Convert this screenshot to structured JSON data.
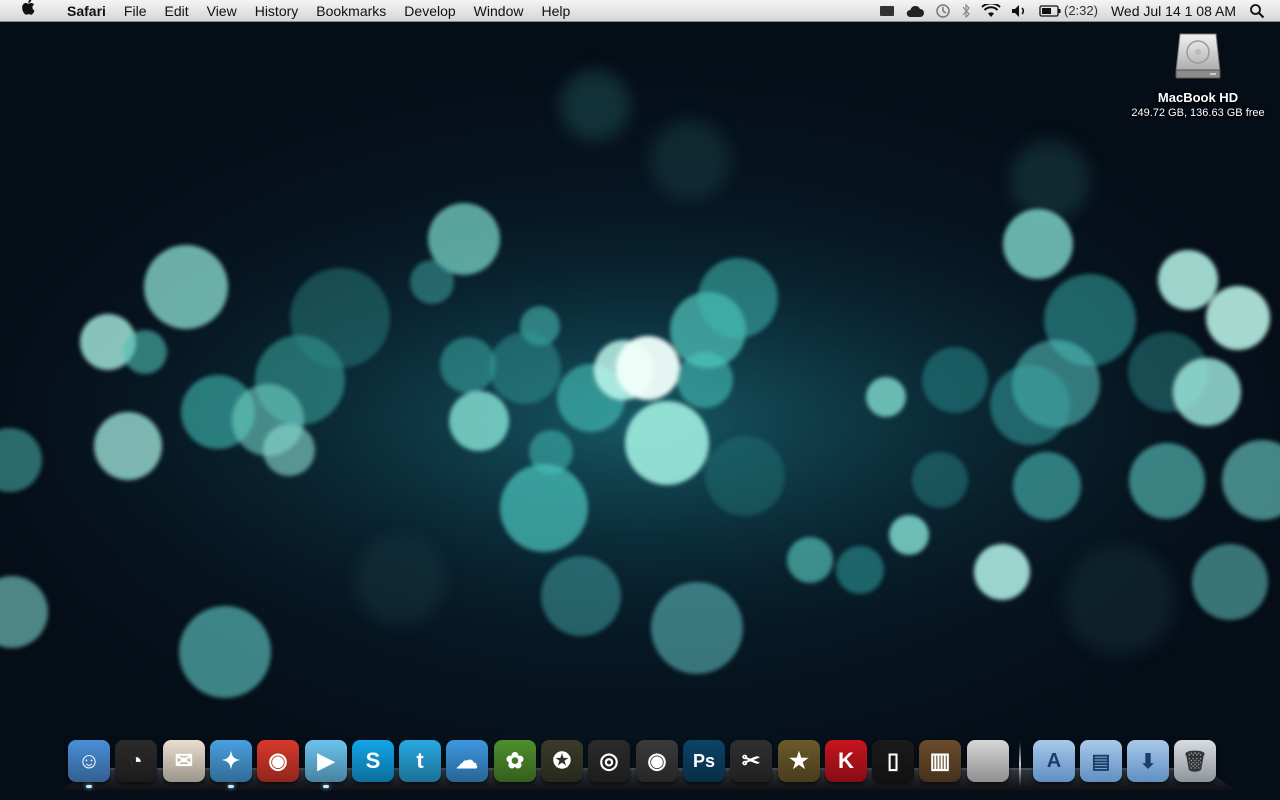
{
  "menubar": {
    "app_name": "Safari",
    "items": [
      "File",
      "Edit",
      "View",
      "History",
      "Bookmarks",
      "Develop",
      "Window",
      "Help"
    ],
    "battery_text": "(2:32)",
    "clock": "Wed Jul 14  1 08 AM",
    "status_icons": [
      "notification-icon",
      "cloud-icon",
      "time-machine-icon",
      "bluetooth-icon",
      "wifi-icon",
      "volume-icon",
      "battery-icon",
      "spotlight-icon"
    ]
  },
  "desktop": {
    "disk_name": "MacBook HD",
    "disk_info": "249.72 GB, 136.63 GB free"
  },
  "dock": {
    "apps": [
      {
        "icon": "finder-icon",
        "color": "#4a8fd8",
        "glyph": "☺"
      },
      {
        "icon": "dashboard-icon",
        "color": "#2a2a2a",
        "glyph": "◔"
      },
      {
        "icon": "mail-icon",
        "color": "#e9dfcf",
        "glyph": "✉"
      },
      {
        "icon": "safari-icon",
        "color": "#4aa0e0",
        "glyph": "✦"
      },
      {
        "icon": "chrome-icon",
        "color": "#d8392b",
        "glyph": "◉"
      },
      {
        "icon": "facetime-icon",
        "color": "#6cc3ef",
        "glyph": "▶"
      },
      {
        "icon": "skype-icon",
        "color": "#12a5e8",
        "glyph": "S"
      },
      {
        "icon": "twitter-icon",
        "color": "#29a9e1",
        "glyph": "t"
      },
      {
        "icon": "icloud-icon",
        "color": "#3d97e0",
        "glyph": "☁"
      },
      {
        "icon": "plants-vs-zombies-icon",
        "color": "#4e8f2c",
        "glyph": "✿"
      },
      {
        "icon": "call-of-duty-icon",
        "color": "#3b3b2b",
        "glyph": "✪"
      },
      {
        "icon": "dvd-player-icon",
        "color": "#2b2b2b",
        "glyph": "◎"
      },
      {
        "icon": "photo-booth-icon",
        "color": "#3a3a3a",
        "glyph": "◉"
      },
      {
        "icon": "photoshop-icon",
        "color": "#0c4468",
        "glyph": "Ps"
      },
      {
        "icon": "final-cut-icon",
        "color": "#303030",
        "glyph": "✂"
      },
      {
        "icon": "imovie-icon",
        "color": "#6b5a2a",
        "glyph": "★"
      },
      {
        "icon": "kitkat-icon",
        "color": "#c8141e",
        "glyph": "K"
      },
      {
        "icon": "iphone-icon",
        "color": "#1a1a1a",
        "glyph": "▯"
      },
      {
        "icon": "books-icon",
        "color": "#6a4a2a",
        "glyph": "▥"
      },
      {
        "icon": "system-preferences-icon",
        "color": "#d7d7d7",
        "glyph": ""
      }
    ],
    "folders": [
      {
        "icon": "applications-folder-icon",
        "glyph": "A"
      },
      {
        "icon": "documents-folder-icon",
        "glyph": "▤"
      },
      {
        "icon": "downloads-folder-icon",
        "glyph": "⬇"
      },
      {
        "icon": "trash-icon",
        "glyph": "🗑"
      }
    ]
  }
}
